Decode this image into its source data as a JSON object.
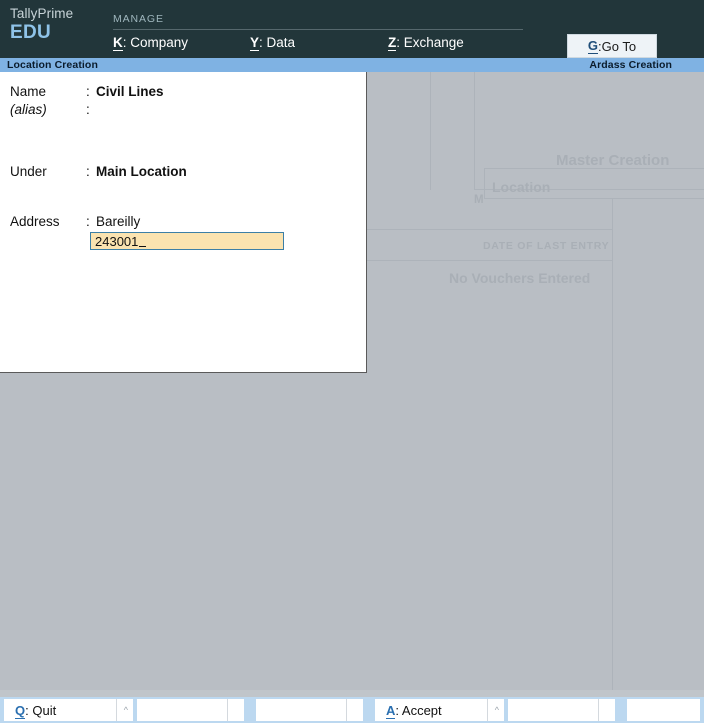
{
  "header": {
    "brand_name": "TallyPrime",
    "brand_edition": "EDU",
    "section_label": "MANAGE",
    "menu": [
      {
        "key": "K",
        "sep": ": ",
        "label": "Company"
      },
      {
        "key": "Y",
        "sep": ": ",
        "label": "Data"
      },
      {
        "key": "Z",
        "sep": ": ",
        "label": "Exchange"
      }
    ],
    "goto_button": {
      "key": "G",
      "sep": ": ",
      "label": "Go To"
    }
  },
  "title_bar": {
    "left": "Location Creation",
    "right": "Ardass Creation"
  },
  "form": {
    "rows": [
      {
        "label": "Name",
        "colon": ":",
        "value": "Civil Lines"
      },
      {
        "label": "(alias)",
        "colon": ":",
        "value": ""
      },
      {
        "label": "Under",
        "colon": ":",
        "value": "Main Location"
      },
      {
        "label": "Address",
        "colon": ":",
        "value": "Bareilly"
      }
    ],
    "address_input": {
      "value": "243001",
      "placeholder": ""
    }
  },
  "backdrop": {
    "master_creation": "Master Creation",
    "location": "Location",
    "m_fragment": "M",
    "date_of_last_entry": "DATE OF LAST ENTRY",
    "no_vouchers": "No Vouchers Entered"
  },
  "bottom_bar": {
    "buttons": [
      {
        "key": "Q",
        "sep": ": ",
        "label": "Quit"
      },
      {
        "key": "",
        "sep": "",
        "label": ""
      },
      {
        "key": "",
        "sep": "",
        "label": ""
      },
      {
        "key": "A",
        "sep": ": ",
        "label": "Accept"
      },
      {
        "key": "",
        "sep": "",
        "label": ""
      },
      {
        "key": "",
        "sep": "",
        "label": ""
      }
    ],
    "more_caret": "^"
  },
  "colors": {
    "header_bg": "#22363a",
    "title_bar_bg": "#7fb2e3",
    "backdrop_bg": "#b9bec4",
    "input_bg": "#fae3b0",
    "input_border": "#3c7fa6",
    "hotkey_blue": "#2a6fb0",
    "brand_edu": "#8fc3e8",
    "bottom_strip": "#bcd8f0"
  }
}
